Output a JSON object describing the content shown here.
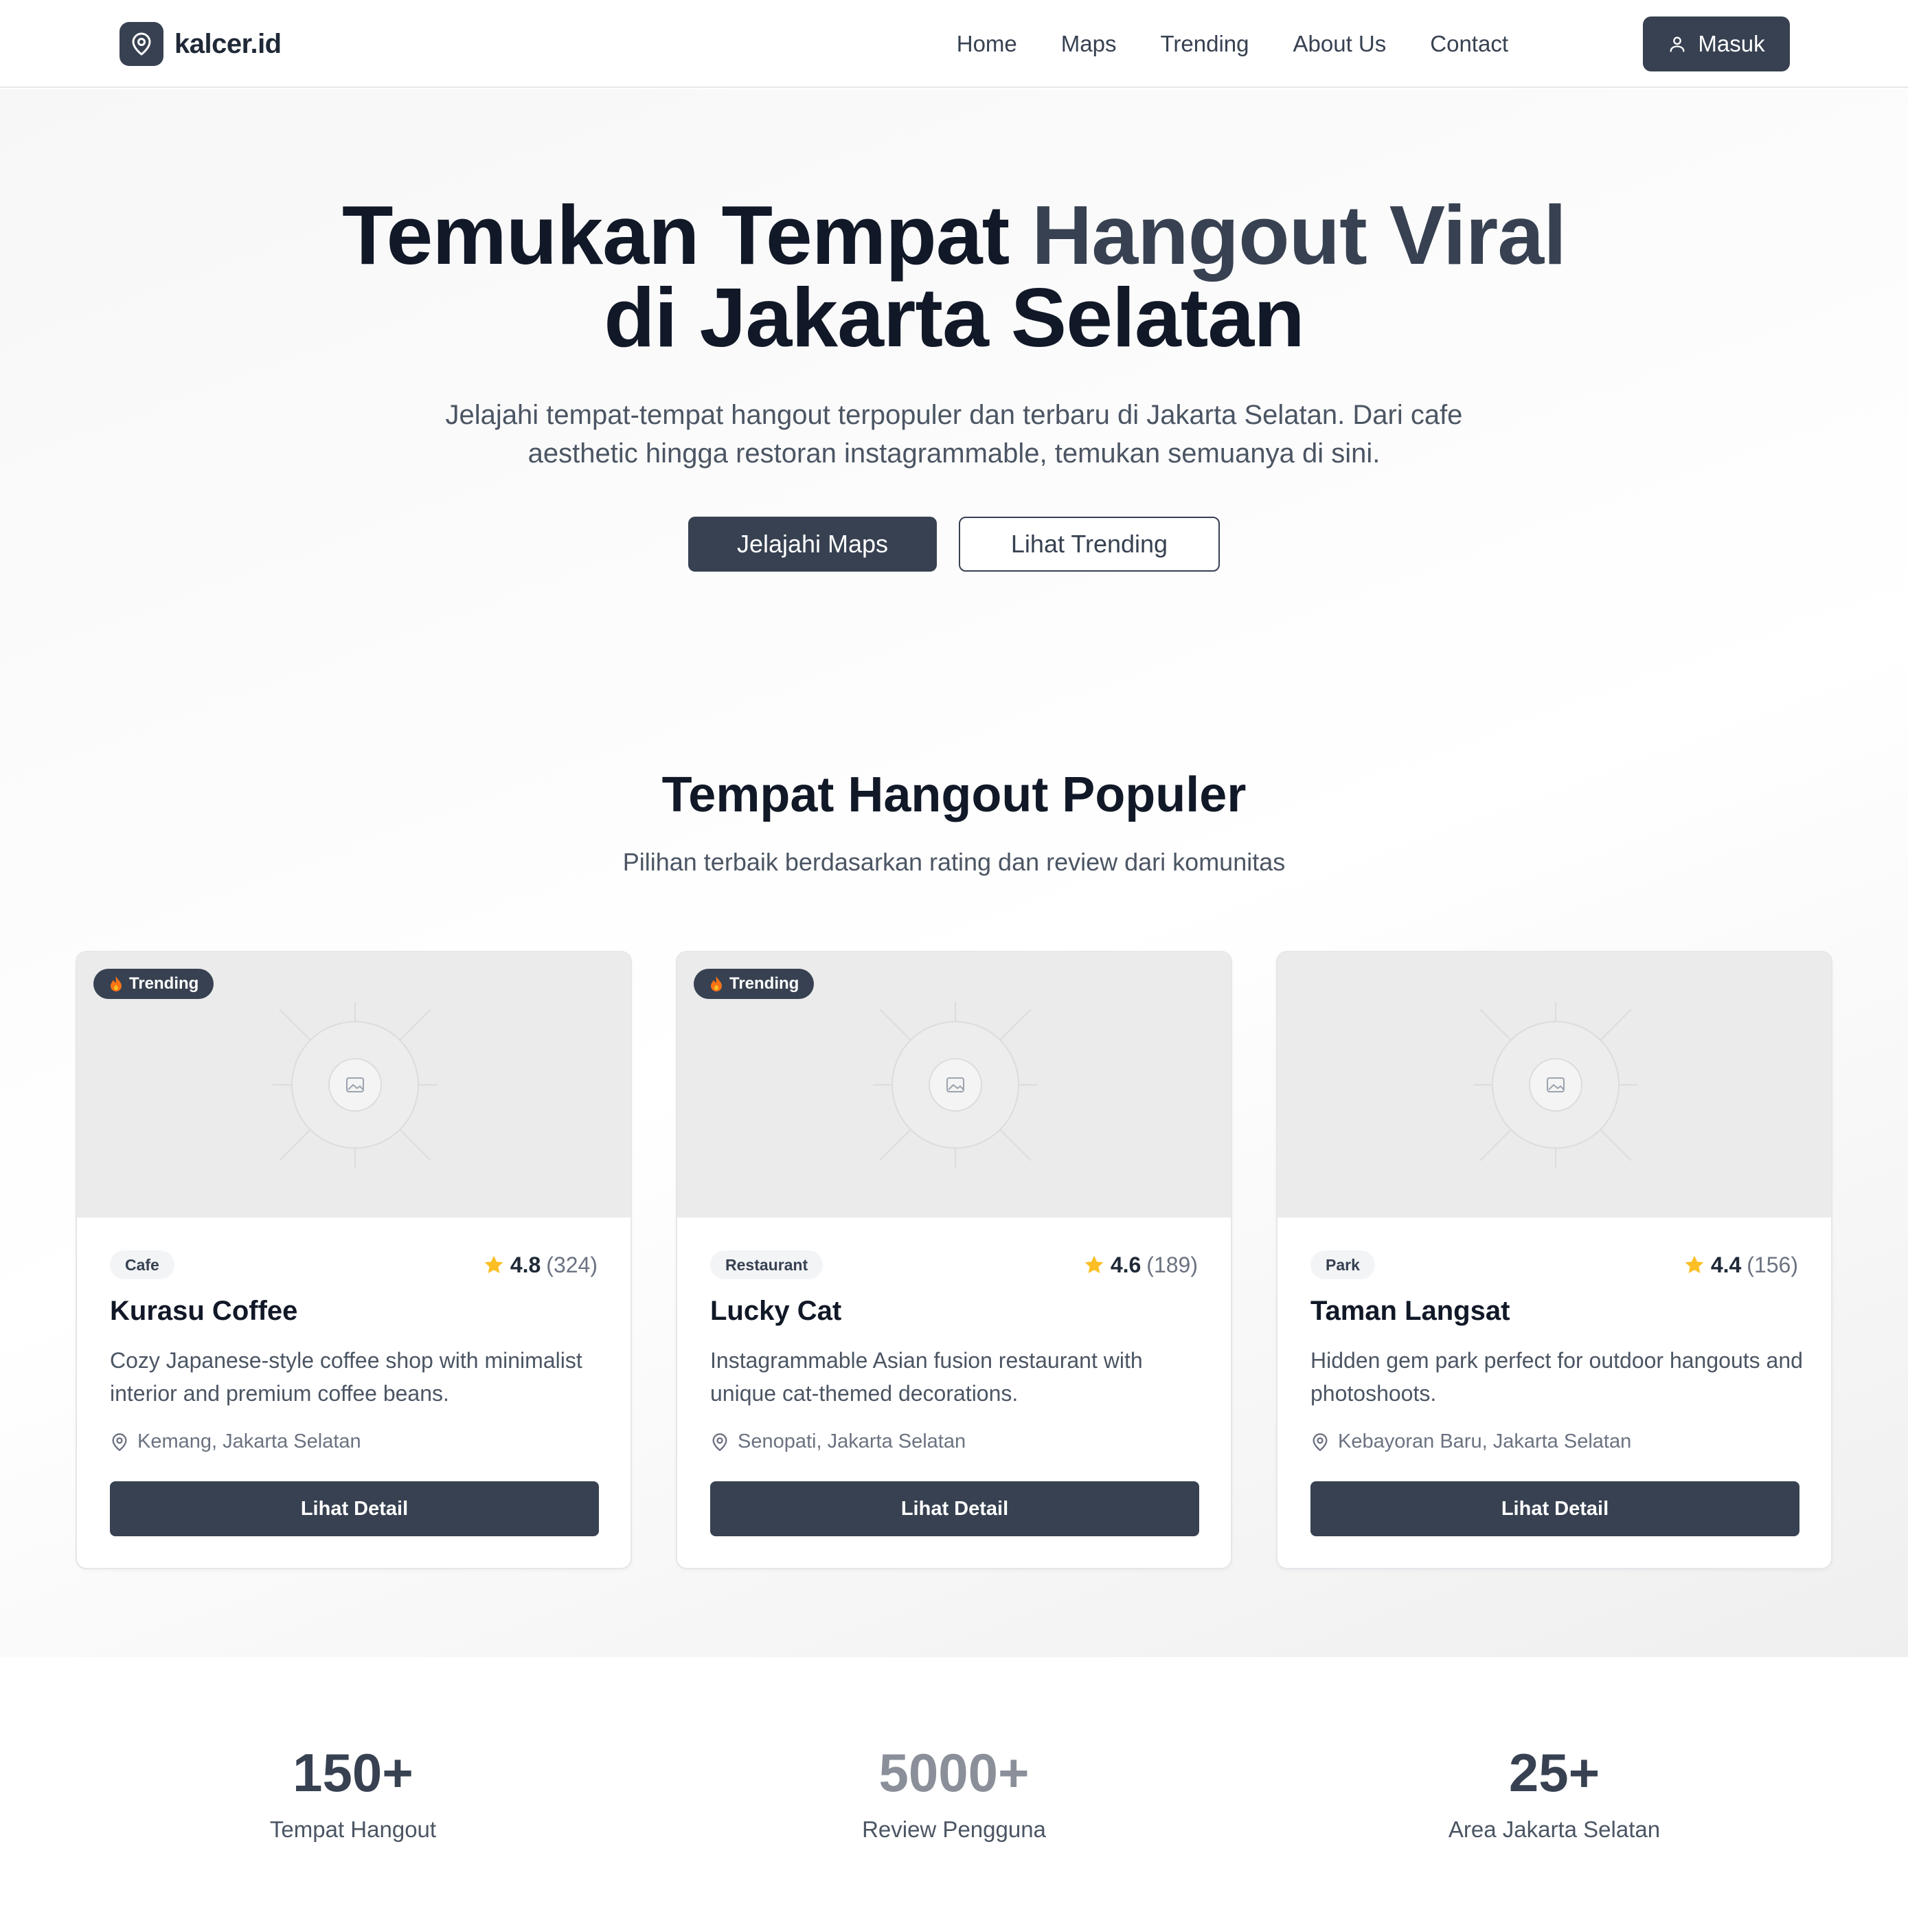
{
  "brand": {
    "name": "kalcer.id"
  },
  "nav": {
    "links": [
      "Home",
      "Maps",
      "Trending",
      "About Us",
      "Contact"
    ],
    "login_label": "Masuk"
  },
  "hero": {
    "title_part1": "Temukan Tempat ",
    "title_accent": "Hangout Viral",
    "title_line2": "di Jakarta Selatan",
    "subtitle": "Jelajahi tempat-tempat hangout terpopuler dan terbaru di Jakarta Selatan. Dari cafe aesthetic hingga restoran instagrammable, temukan semuanya di sini.",
    "primary_button": "Jelajahi Maps",
    "secondary_button": "Lihat Trending"
  },
  "popular": {
    "title": "Tempat Hangout Populer",
    "subtitle": "Pilihan terbaik berdasarkan rating dan review dari komunitas",
    "cards": [
      {
        "badge": "Trending",
        "category": "Cafe",
        "rating": "4.8",
        "reviews": "(324)",
        "name": "Kurasu Coffee",
        "description": "Cozy Japanese-style coffee shop with minimalist interior and premium coffee beans.",
        "location": "Kemang, Jakarta Selatan",
        "button": "Lihat Detail"
      },
      {
        "badge": "Trending",
        "category": "Restaurant",
        "rating": "4.6",
        "reviews": "(189)",
        "name": "Lucky Cat",
        "description": "Instagrammable Asian fusion restaurant with unique cat-themed decorations.",
        "location": "Senopati, Jakarta Selatan",
        "button": "Lihat Detail"
      },
      {
        "badge": "",
        "category": "Park",
        "rating": "4.4",
        "reviews": "(156)",
        "name": "Taman Langsat",
        "description": "Hidden gem park perfect for outdoor hangouts and photoshoots.",
        "location": "Kebayoran Baru, Jakarta Selatan",
        "button": "Lihat Detail"
      }
    ]
  },
  "stats": [
    {
      "value": "150+",
      "label": "Tempat Hangout",
      "color": "#374151"
    },
    {
      "value": "5000+",
      "label": "Review Pengguna",
      "color": "#8a8f99"
    },
    {
      "value": "25+",
      "label": "Area Jakarta Selatan",
      "color": "#374151"
    }
  ],
  "colors": {
    "primary": "#374151",
    "star": "#fbbf24",
    "badge_flame": "#f97316"
  }
}
